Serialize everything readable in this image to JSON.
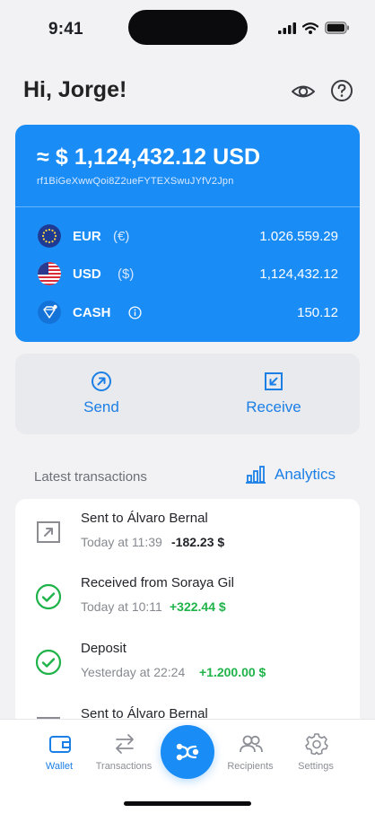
{
  "status_bar": {
    "time": "9:41",
    "icons": [
      "signal-icon",
      "wifi-icon",
      "battery-icon"
    ]
  },
  "header": {
    "greeting": "Hi, Jorge!",
    "icons": [
      "eye-icon",
      "help-icon"
    ]
  },
  "balance": {
    "total": "≈ $ 1,124,432.12 USD",
    "address": "rf1BiGeXwwQoi8Z2ueFYTEXSwuJYfV2Jpn",
    "currencies": [
      {
        "code": "EUR",
        "symbol": "(€)",
        "amount": "1.026.559.29",
        "icon": "eu-flag-icon"
      },
      {
        "code": "USD",
        "symbol": "($)",
        "amount": "1,124,432.12",
        "icon": "us-flag-icon"
      },
      {
        "code": "CASH",
        "symbol": "",
        "amount": "150.12",
        "icon": "cash-diamond-icon"
      }
    ],
    "colors": {
      "card": "#1a8cf5"
    }
  },
  "actions": {
    "send_label": "Send",
    "receive_label": "Receive"
  },
  "transactions": {
    "heading": "Latest transactions",
    "analytics_label": "Analytics",
    "items": [
      {
        "title": "Sent to Álvaro Bernal",
        "date": "Today at 11:39",
        "amount": "-182.23 $",
        "kind": "sent",
        "icon": "arrow-up-right-icon"
      },
      {
        "title": "Received from Soraya Gil",
        "date": "Today at 10:11",
        "amount": "+322.44 $",
        "kind": "received",
        "icon": "check-circle-icon"
      },
      {
        "title": "Deposit",
        "date": "Yesterday at 22:24",
        "amount": "+1.200.00 $",
        "kind": "received",
        "icon": "check-circle-icon"
      },
      {
        "title": "Sent to Álvaro Bernal",
        "date": "",
        "amount": "",
        "kind": "sent",
        "icon": "arrow-up-right-icon"
      }
    ],
    "colors": {
      "positive": "#1fb34a",
      "negative": "#23242a",
      "accent": "#1b7fe6"
    }
  },
  "tabbar": {
    "tabs": [
      {
        "label": "Wallet",
        "icon": "wallet-icon",
        "active": true
      },
      {
        "label": "Transactions",
        "icon": "swap-arrows-icon",
        "active": false
      },
      {
        "label": "Recipients",
        "icon": "people-icon",
        "active": false
      },
      {
        "label": "Settings",
        "icon": "gear-icon",
        "active": false
      }
    ],
    "center_icon": "ripple-logo-icon"
  }
}
